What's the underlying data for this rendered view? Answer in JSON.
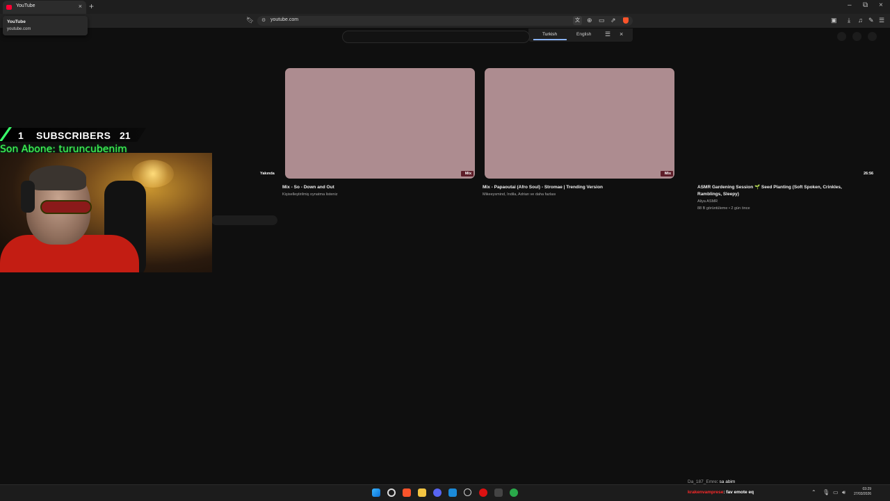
{
  "browser": {
    "tab_title": "YouTube",
    "tab_close": "×",
    "new_tab": "+",
    "url": "youtube.com",
    "win_min": "–",
    "win_max": "⧉",
    "win_close": "×"
  },
  "tooltip": {
    "title": "YouTube",
    "url": "youtube.com"
  },
  "translate": {
    "source_lang": "Turkish",
    "target_lang": "English",
    "menu": "☰",
    "close": "×"
  },
  "videos": [
    {
      "title": "Mix - So - Down and Out",
      "meta": "Kişiselleştirilmiş oynatma listeniz",
      "badge": "Mix"
    },
    {
      "title": "Mix - Papaoutai (Afro Soul) - Stromae | Trending Version",
      "meta": "Mikeeysmind, Indila, Adrian ve daha fazlası",
      "badge": "Mix"
    },
    {
      "title": "ASMR Gardening Session 🌱 Seed Planting (Soft Spoken, Crinkles, Ramblings, Sleepy)",
      "channel": "Aliya ASMR",
      "meta": "88 B görüntüleme • 2 gün önce",
      "duration": "26:56"
    }
  ],
  "upcoming_label": "Yakında",
  "overlay": {
    "sub_left": "1",
    "sub_label": "SUBSCRIBERS",
    "sub_right": "21",
    "last_sub": "Son Abone: turuncubenim"
  },
  "chat": [
    {
      "user": "Da_187_Emre",
      "message": ": sa abim"
    },
    {
      "user": "krakenvamprese",
      "message": ": fav emote eq"
    }
  ],
  "clock": {
    "time": "03:29",
    "date": "27/03/2026"
  },
  "colors": {
    "thumbnail": "#ad8c90",
    "mix_badge": "#5e1e29",
    "overlay_green": "#48ff5a",
    "brave_orange": "#fb542b"
  }
}
